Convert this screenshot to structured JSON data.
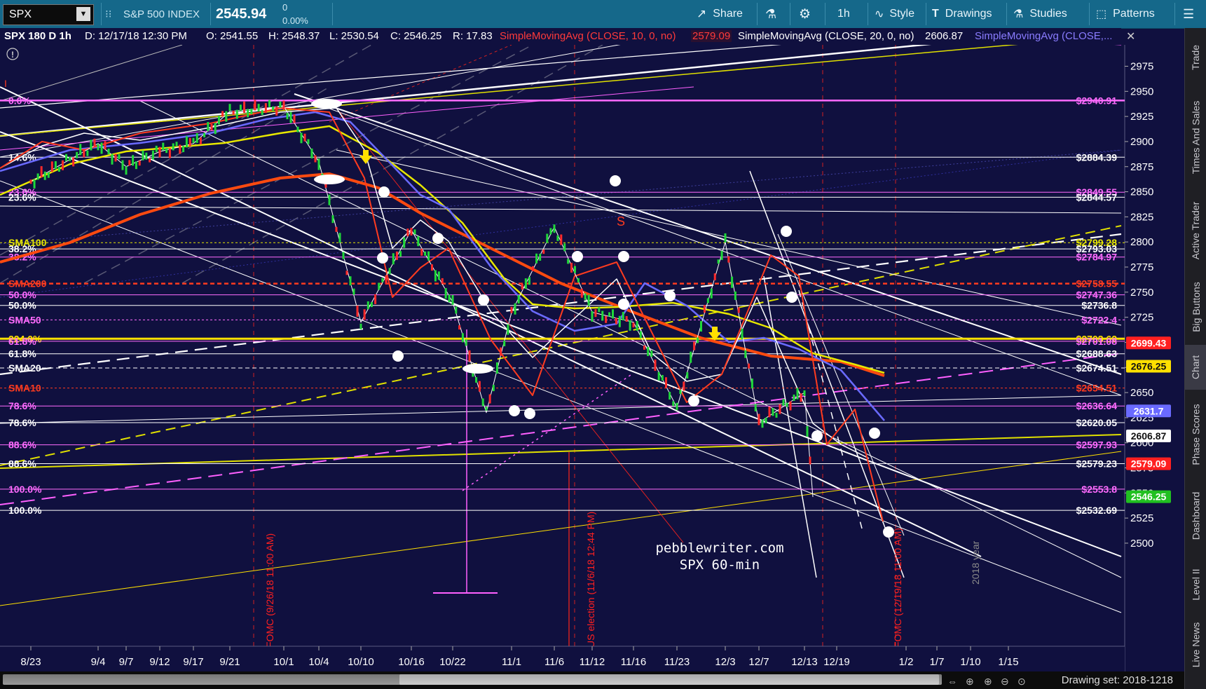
{
  "toolbar": {
    "symbol": "SPX",
    "index_name": "S&P 500 INDEX",
    "price": "2545.94",
    "change": "0",
    "change_pct": "0.00%",
    "share": "Share",
    "timeframe": "1h",
    "style": "Style",
    "drawings": "Drawings",
    "studies": "Studies",
    "patterns": "Patterns"
  },
  "info": {
    "title": "SPX 180 D 1h",
    "date": "D: 12/17/18 12:30 PM",
    "open": "O: 2541.55",
    "high": "H: 2548.37",
    "low": "L: 2530.54",
    "close": "C: 2546.25",
    "range": "R: 17.83",
    "sma10_label": "SimpleMovingAvg (CLOSE, 10, 0, no)",
    "sma10_value": "2579.09",
    "sma20_label": "SimpleMovingAvg (CLOSE, 20, 0, no)",
    "sma20_value": "2606.87",
    "sma_more": "SimpleMovingAvg (CLOSE,..."
  },
  "colors": {
    "background": "#10103f",
    "sma10": "#ff3b1f",
    "sma20": "#ffffff",
    "sma50": "#6a6aff",
    "sma100": "#e8e800",
    "sma200": "#ff4a10",
    "fib": "#ff6bff"
  },
  "chart_data": {
    "type": "line",
    "title": "SPX 180 D 1h",
    "ylim": [
      2488,
      2990
    ],
    "y_ticks": [
      2975,
      2950,
      2925,
      2900,
      2875,
      2850,
      2825,
      2800,
      2775,
      2750,
      2725,
      2700,
      2675,
      2650,
      2625,
      2600,
      2575,
      2550,
      2525,
      2500
    ],
    "x_ticks": [
      "8/23",
      "9/4",
      "9/7",
      "9/12",
      "9/17",
      "9/21",
      "10/1",
      "10/4",
      "10/10",
      "10/16",
      "10/22",
      "11/1",
      "11/6",
      "11/12",
      "11/16",
      "11/23",
      "12/3",
      "12/7",
      "12/13",
      "12/19",
      "1/2",
      "1/7",
      "1/10",
      "1/15"
    ],
    "price_path": [
      [
        "8/23",
        2860
      ],
      [
        "9/4",
        2898
      ],
      [
        "9/7",
        2875
      ],
      [
        "9/12",
        2890
      ],
      [
        "9/17",
        2898
      ],
      [
        "9/21",
        2930
      ],
      [
        "10/1",
        2935
      ],
      [
        "10/4",
        2880
      ],
      [
        "10/10",
        2720
      ],
      [
        "10/16",
        2812
      ],
      [
        "10/22",
        2740
      ],
      [
        "10/29",
        2630
      ],
      [
        "11/1",
        2730
      ],
      [
        "11/6",
        2815
      ],
      [
        "11/12",
        2730
      ],
      [
        "11/16",
        2720
      ],
      [
        "11/23",
        2635
      ],
      [
        "12/3",
        2800
      ],
      [
        "12/7",
        2620
      ],
      [
        "12/13",
        2650
      ],
      [
        "12/17",
        2546
      ]
    ],
    "horizontal_levels": [
      {
        "price": 2940.91,
        "label": "$2940.91",
        "left_label": "0.0%"
      },
      {
        "price": 2884.39,
        "label": "$2884.39",
        "left_label": "14.6%"
      },
      {
        "price": 2849.55,
        "label": "$2849.55",
        "left_label": "23.6%"
      },
      {
        "price": 2844.57,
        "label": "$2844.57",
        "left_label": "23.6%"
      },
      {
        "price": 2799.28,
        "label": "$2799.28",
        "left_label": "SMA100"
      },
      {
        "price": 2793.03,
        "label": "$2793.03",
        "left_label": "38.2%"
      },
      {
        "price": 2784.97,
        "label": "$2784.97",
        "left_label": "38.2%"
      },
      {
        "price": 2758.55,
        "label": "$2758.55",
        "left_label": "SMA200"
      },
      {
        "price": 2747.36,
        "label": "$2747.36",
        "left_label": "50.0%"
      },
      {
        "price": 2736.8,
        "label": "$2736.8",
        "left_label": "50.0%"
      },
      {
        "price": 2722.4,
        "label": "$2722.4",
        "left_label": "SMA50"
      },
      {
        "price": 2703.62,
        "label": "$2703.62",
        "left_label": "224.0%"
      },
      {
        "price": 2701.08,
        "label": "$2701.08",
        "left_label": "61.8%"
      },
      {
        "price": 2688.63,
        "label": "$2688.63",
        "left_label": "61.8%"
      },
      {
        "price": 2674.51,
        "label": "$2674.51",
        "left_label": "SMA20"
      },
      {
        "price": 2654.51,
        "label": "$2654.51",
        "left_label": "SMA10"
      },
      {
        "price": 2636.64,
        "label": "$2636.64",
        "left_label": "78.6%"
      },
      {
        "price": 2620.05,
        "label": "$2620.05",
        "left_label": "78.6%"
      },
      {
        "price": 2597.93,
        "label": "$2597.93",
        "left_label": "88.6%"
      },
      {
        "price": 2579.23,
        "label": "$2579.23",
        "left_label": "88.6%"
      },
      {
        "price": 2553.8,
        "label": "$2553.8",
        "left_label": "100.0%"
      },
      {
        "price": 2532.69,
        "label": "$2532.69",
        "left_label": "100.0%"
      }
    ],
    "price_badges": [
      {
        "price": 2699.43,
        "label": "2699.43"
      },
      {
        "price": 2676.25,
        "label": "2676.25"
      },
      {
        "price": 2631.7,
        "label": "2631.7"
      },
      {
        "price": 2606.87,
        "label": "2606.87"
      },
      {
        "price": 2579.09,
        "label": "2579.09"
      },
      {
        "price": 2546.25,
        "label": "2546.25"
      }
    ],
    "events": [
      {
        "date": "9/26",
        "label": "FOMC (9/26/18 11:00 AM)"
      },
      {
        "date": "11/6",
        "label": "US election (11/6/18 12:44 PM)"
      },
      {
        "date": "12/19",
        "label": "FOMC (12/19/18 11:00 AM)"
      }
    ],
    "annotations": [
      "S",
      "pebblewriter.com",
      "SPX 60-min",
      "2018 year"
    ]
  },
  "right_tabs": [
    "Trade",
    "Times And Sales",
    "Active Trader",
    "Big Buttons",
    "Chart",
    "Phase Scores",
    "Dashboard",
    "Level II",
    "Live News"
  ],
  "footer": {
    "drawing_set": "Drawing set: 2018-1218"
  }
}
